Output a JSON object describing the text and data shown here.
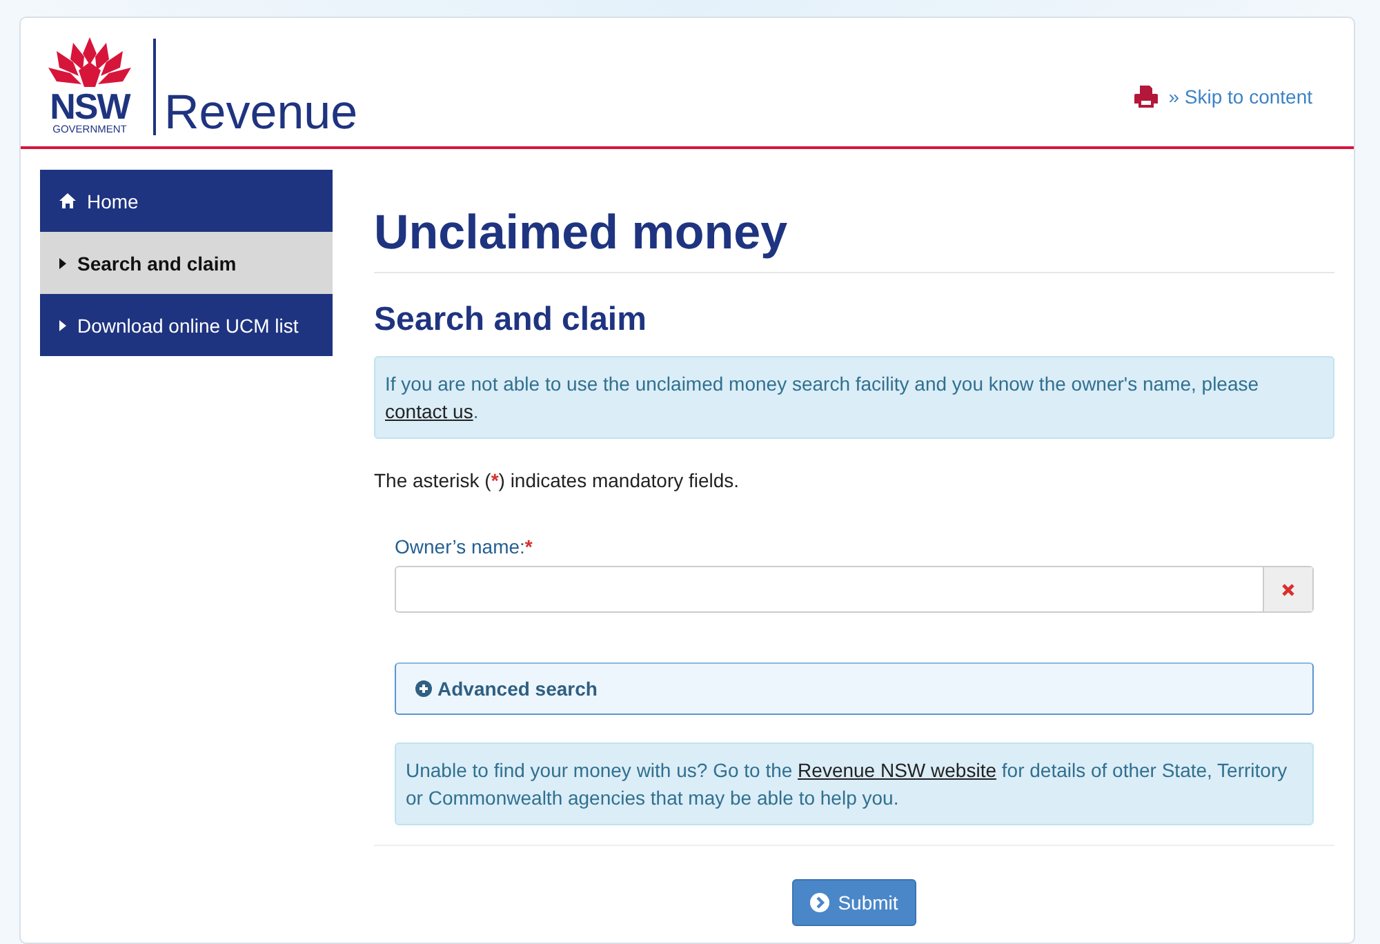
{
  "header": {
    "logo_mark": "NSW",
    "logo_sub": "GOVERNMENT",
    "brand": "Revenue",
    "skip_glyph": "»",
    "skip_link": "Skip to content"
  },
  "sidebar": {
    "items": [
      {
        "label": "Home",
        "kind": "home",
        "selected": false
      },
      {
        "label": "Search and claim",
        "kind": "arrow",
        "selected": true
      },
      {
        "label": "Download online UCM list",
        "kind": "arrow",
        "selected": false
      }
    ]
  },
  "main": {
    "title": "Unclaimed money",
    "subtitle": "Search and claim",
    "notice": {
      "before": "If you are not able to use the unclaimed money search facility and you know the owner's name, please ",
      "link": "contact us",
      "after": "."
    },
    "mandatory_note": {
      "before": "The asterisk (",
      "mark": "*",
      "after": ") indicates mandatory fields."
    },
    "field": {
      "label": "Owner’s name:",
      "required": true,
      "required_mark": "*"
    },
    "advanced": {
      "label": "Advanced search",
      "expanded": false
    },
    "help": {
      "before": "Unable to find your money with us? Go to the ",
      "link": "Revenue NSW website",
      "after": " for details of other State, Territory or Commonwealth agencies that may be able to help you."
    },
    "submit": "Submit"
  }
}
